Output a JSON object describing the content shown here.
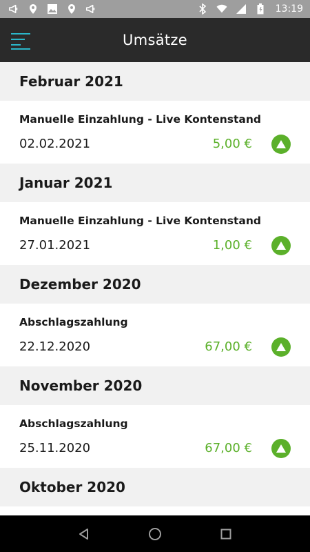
{
  "statusbar": {
    "time": "13:19",
    "left_icons": [
      "megaphone-icon",
      "location-pin-icon",
      "image-icon",
      "location-pin-icon",
      "megaphone-icon"
    ],
    "right_icons": [
      "bluetooth-icon",
      "wifi-icon",
      "signal-icon",
      "battery-icon"
    ]
  },
  "appbar": {
    "title": "Umsätze",
    "menu_icon": "menu-icon",
    "accent": "#2bb6c9"
  },
  "colors": {
    "positive": "#5bb02a",
    "header_bg": "#f1f1f1",
    "appbar_bg": "#2a2a2a"
  },
  "months": [
    {
      "label": "Februar 2021",
      "transactions": [
        {
          "title": "Manuelle Einzahlung - Live Kontenstand",
          "date": "02.02.2021",
          "amount": "5,00 €",
          "icon": "arrow-up-icon"
        }
      ]
    },
    {
      "label": "Januar 2021",
      "transactions": [
        {
          "title": "Manuelle Einzahlung - Live Kontenstand",
          "date": "27.01.2021",
          "amount": "1,00 €",
          "icon": "arrow-up-icon"
        }
      ]
    },
    {
      "label": "Dezember 2020",
      "transactions": [
        {
          "title": "Abschlagszahlung",
          "date": "22.12.2020",
          "amount": "67,00 €",
          "icon": "arrow-up-icon"
        }
      ]
    },
    {
      "label": "November 2020",
      "transactions": [
        {
          "title": "Abschlagszahlung",
          "date": "25.11.2020",
          "amount": "67,00 €",
          "icon": "arrow-up-icon"
        }
      ]
    },
    {
      "label": "Oktober 2020",
      "transactions": []
    }
  ],
  "navbar": {
    "buttons": [
      "back-icon",
      "home-icon",
      "recents-icon"
    ]
  }
}
